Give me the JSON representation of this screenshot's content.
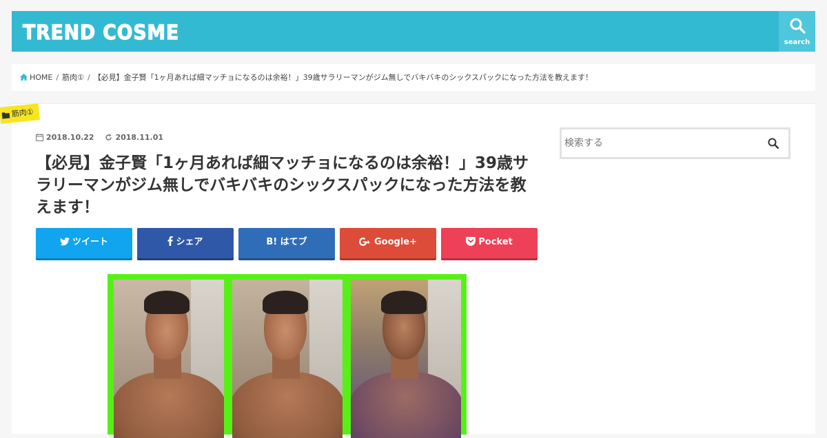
{
  "header": {
    "logo": "TREND COSME",
    "search_label": "search"
  },
  "breadcrumb": {
    "items": [
      "HOME",
      "筋肉①",
      "【必見】金子賢「1ヶ月あれば細マッチョになるのは余裕！」39歳サラリーマンがジム無しでバキバキのシックスパックになった方法を教えます！"
    ],
    "separator": "/"
  },
  "article": {
    "category": "筋肉①",
    "published": "2018.10.22",
    "updated": "2018.11.01",
    "title": "【必見】金子賢「1ヶ月あれば細マッチョになるのは余裕！」39歳サラリーマンがジム無しでバキバキのシックスパックになった方法を教えます！"
  },
  "share": {
    "twitter": "ツイート",
    "facebook": "シェア",
    "hatena": "B! はてブ",
    "google": "Google+",
    "pocket": "Pocket"
  },
  "sidebar": {
    "search_placeholder": "検索する"
  },
  "colors": {
    "header": "#33bad3",
    "tag": "#f7e521",
    "image_frame": "#56f017"
  }
}
